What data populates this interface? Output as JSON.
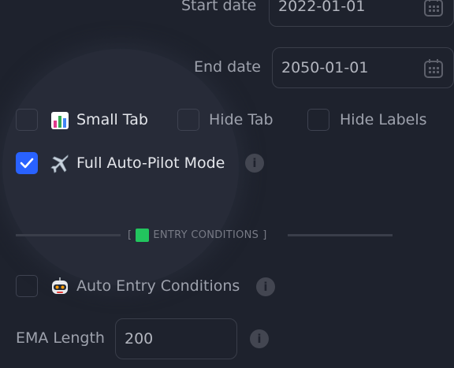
{
  "dates": {
    "start_label": "Start date",
    "start_value": "2022-01-01",
    "end_label": "End date",
    "end_value": "2050-01-01"
  },
  "toggles": {
    "small_tab": {
      "label": "Small Tab",
      "checked": false,
      "icon": "bar-chart-emoji"
    },
    "hide_tab": {
      "label": "Hide Tab",
      "checked": false
    },
    "hide_labels": {
      "label": "Hide Labels",
      "checked": false
    },
    "full_autopilot": {
      "label": "Full Auto-Pilot Mode",
      "checked": true,
      "icon": "airplane-emoji"
    }
  },
  "section": {
    "open_bracket": "[",
    "title": "ENTRY CONDITIONS",
    "close_bracket": "]",
    "marker_color": "#22c55e"
  },
  "entry": {
    "auto_entry_label": "Auto Entry Conditions",
    "auto_entry_checked": false,
    "auto_entry_icon": "robot-emoji",
    "ema_label": "EMA Length",
    "ema_value": "200"
  },
  "info_glyph": "i",
  "colors": {
    "background": "#1e222d",
    "accent": "#2962ff",
    "field_border": "#3a3e4a"
  }
}
